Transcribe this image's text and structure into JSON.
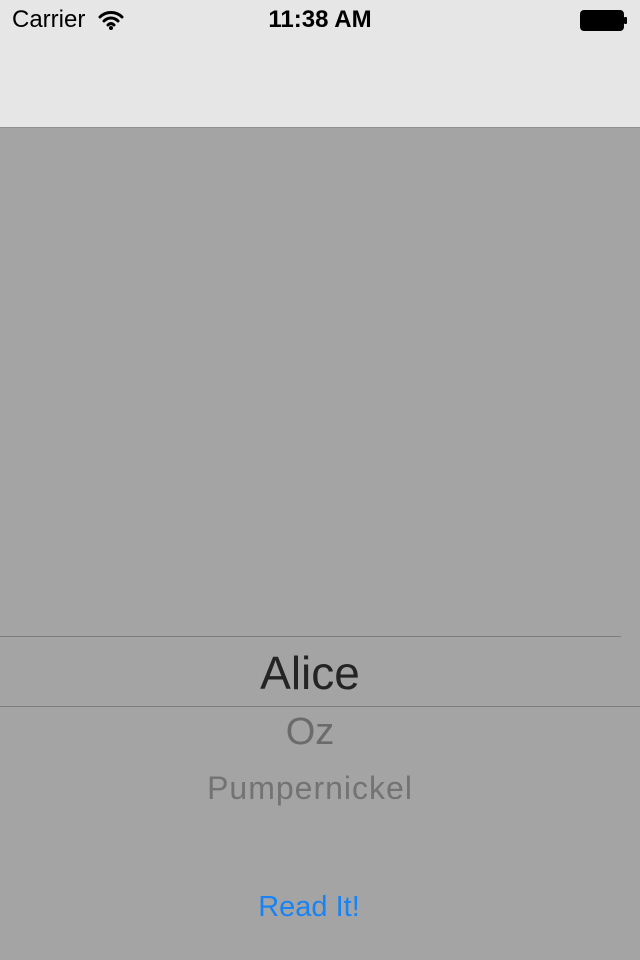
{
  "status_bar": {
    "carrier": "Carrier",
    "time": "11:38 AM",
    "wifi_icon": "wifi-icon",
    "battery_icon": "battery-icon"
  },
  "navigation": {
    "title": ""
  },
  "picker": {
    "selected": "Alice",
    "visible_rows": [
      "Oz",
      "Pumpernickel"
    ]
  },
  "actions": {
    "read_button": "Read It!"
  },
  "colors": {
    "background": "#a4a4a4",
    "bars": "#e6e6e6",
    "button": "#1883f5"
  }
}
